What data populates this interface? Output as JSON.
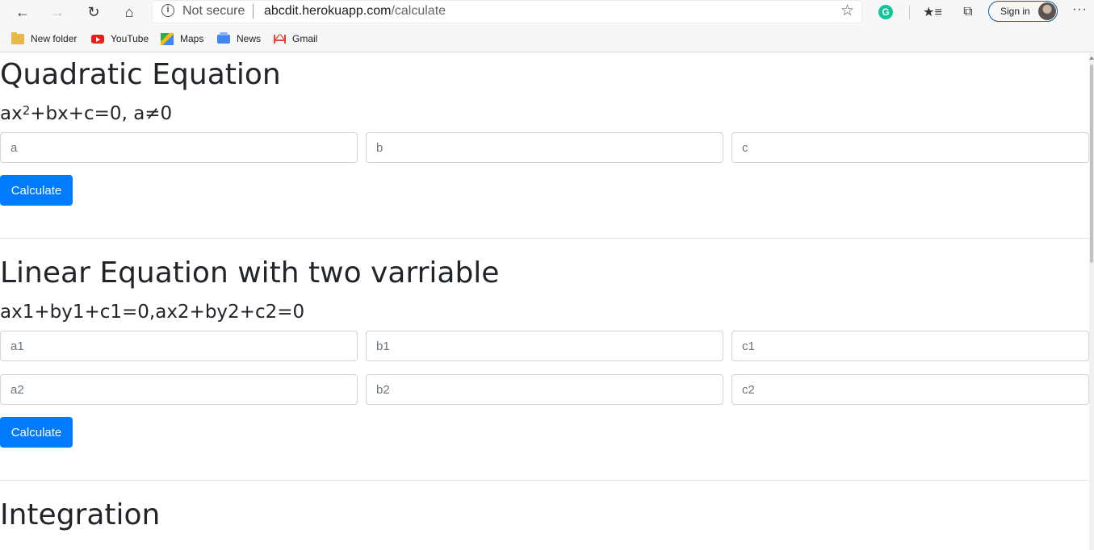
{
  "browser": {
    "security_label": "Not secure",
    "url_host": "abcdit.herokuapp.com",
    "url_path": "/calculate",
    "signin_label": "Sign in",
    "icons": [
      "back-icon",
      "forward-icon",
      "refresh-icon",
      "home-icon",
      "info-icon",
      "star-icon",
      "grammarly-icon",
      "favorites-icon",
      "collections-icon",
      "more-icon"
    ]
  },
  "bookmarks": [
    {
      "label": "New folder",
      "icon": "folder-icon"
    },
    {
      "label": "YouTube",
      "icon": "youtube-icon"
    },
    {
      "label": "Maps",
      "icon": "maps-icon"
    },
    {
      "label": "News",
      "icon": "news-icon"
    },
    {
      "label": "Gmail",
      "icon": "gmail-icon"
    }
  ],
  "quadratic": {
    "title": "Quadratic Equation",
    "formula_part1": "ax",
    "formula_sup": "2",
    "formula_part2": "+bx+c=0, a≠0",
    "placeholders": {
      "a": "a",
      "b": "b",
      "c": "c"
    },
    "button_label": "Calculate"
  },
  "linear": {
    "title": "Linear Equation with two varriable",
    "formula": "ax1+by1+c1=0,ax2+by2+c2=0",
    "placeholders": {
      "a1": "a1",
      "b1": "b1",
      "c1": "c1",
      "a2": "a2",
      "b2": "b2",
      "c2": "c2"
    },
    "button_label": "Calculate"
  },
  "integration": {
    "title": "Integration"
  },
  "colors": {
    "primary_button": "#007bff",
    "text": "#212529",
    "input_border": "#ced4da"
  }
}
